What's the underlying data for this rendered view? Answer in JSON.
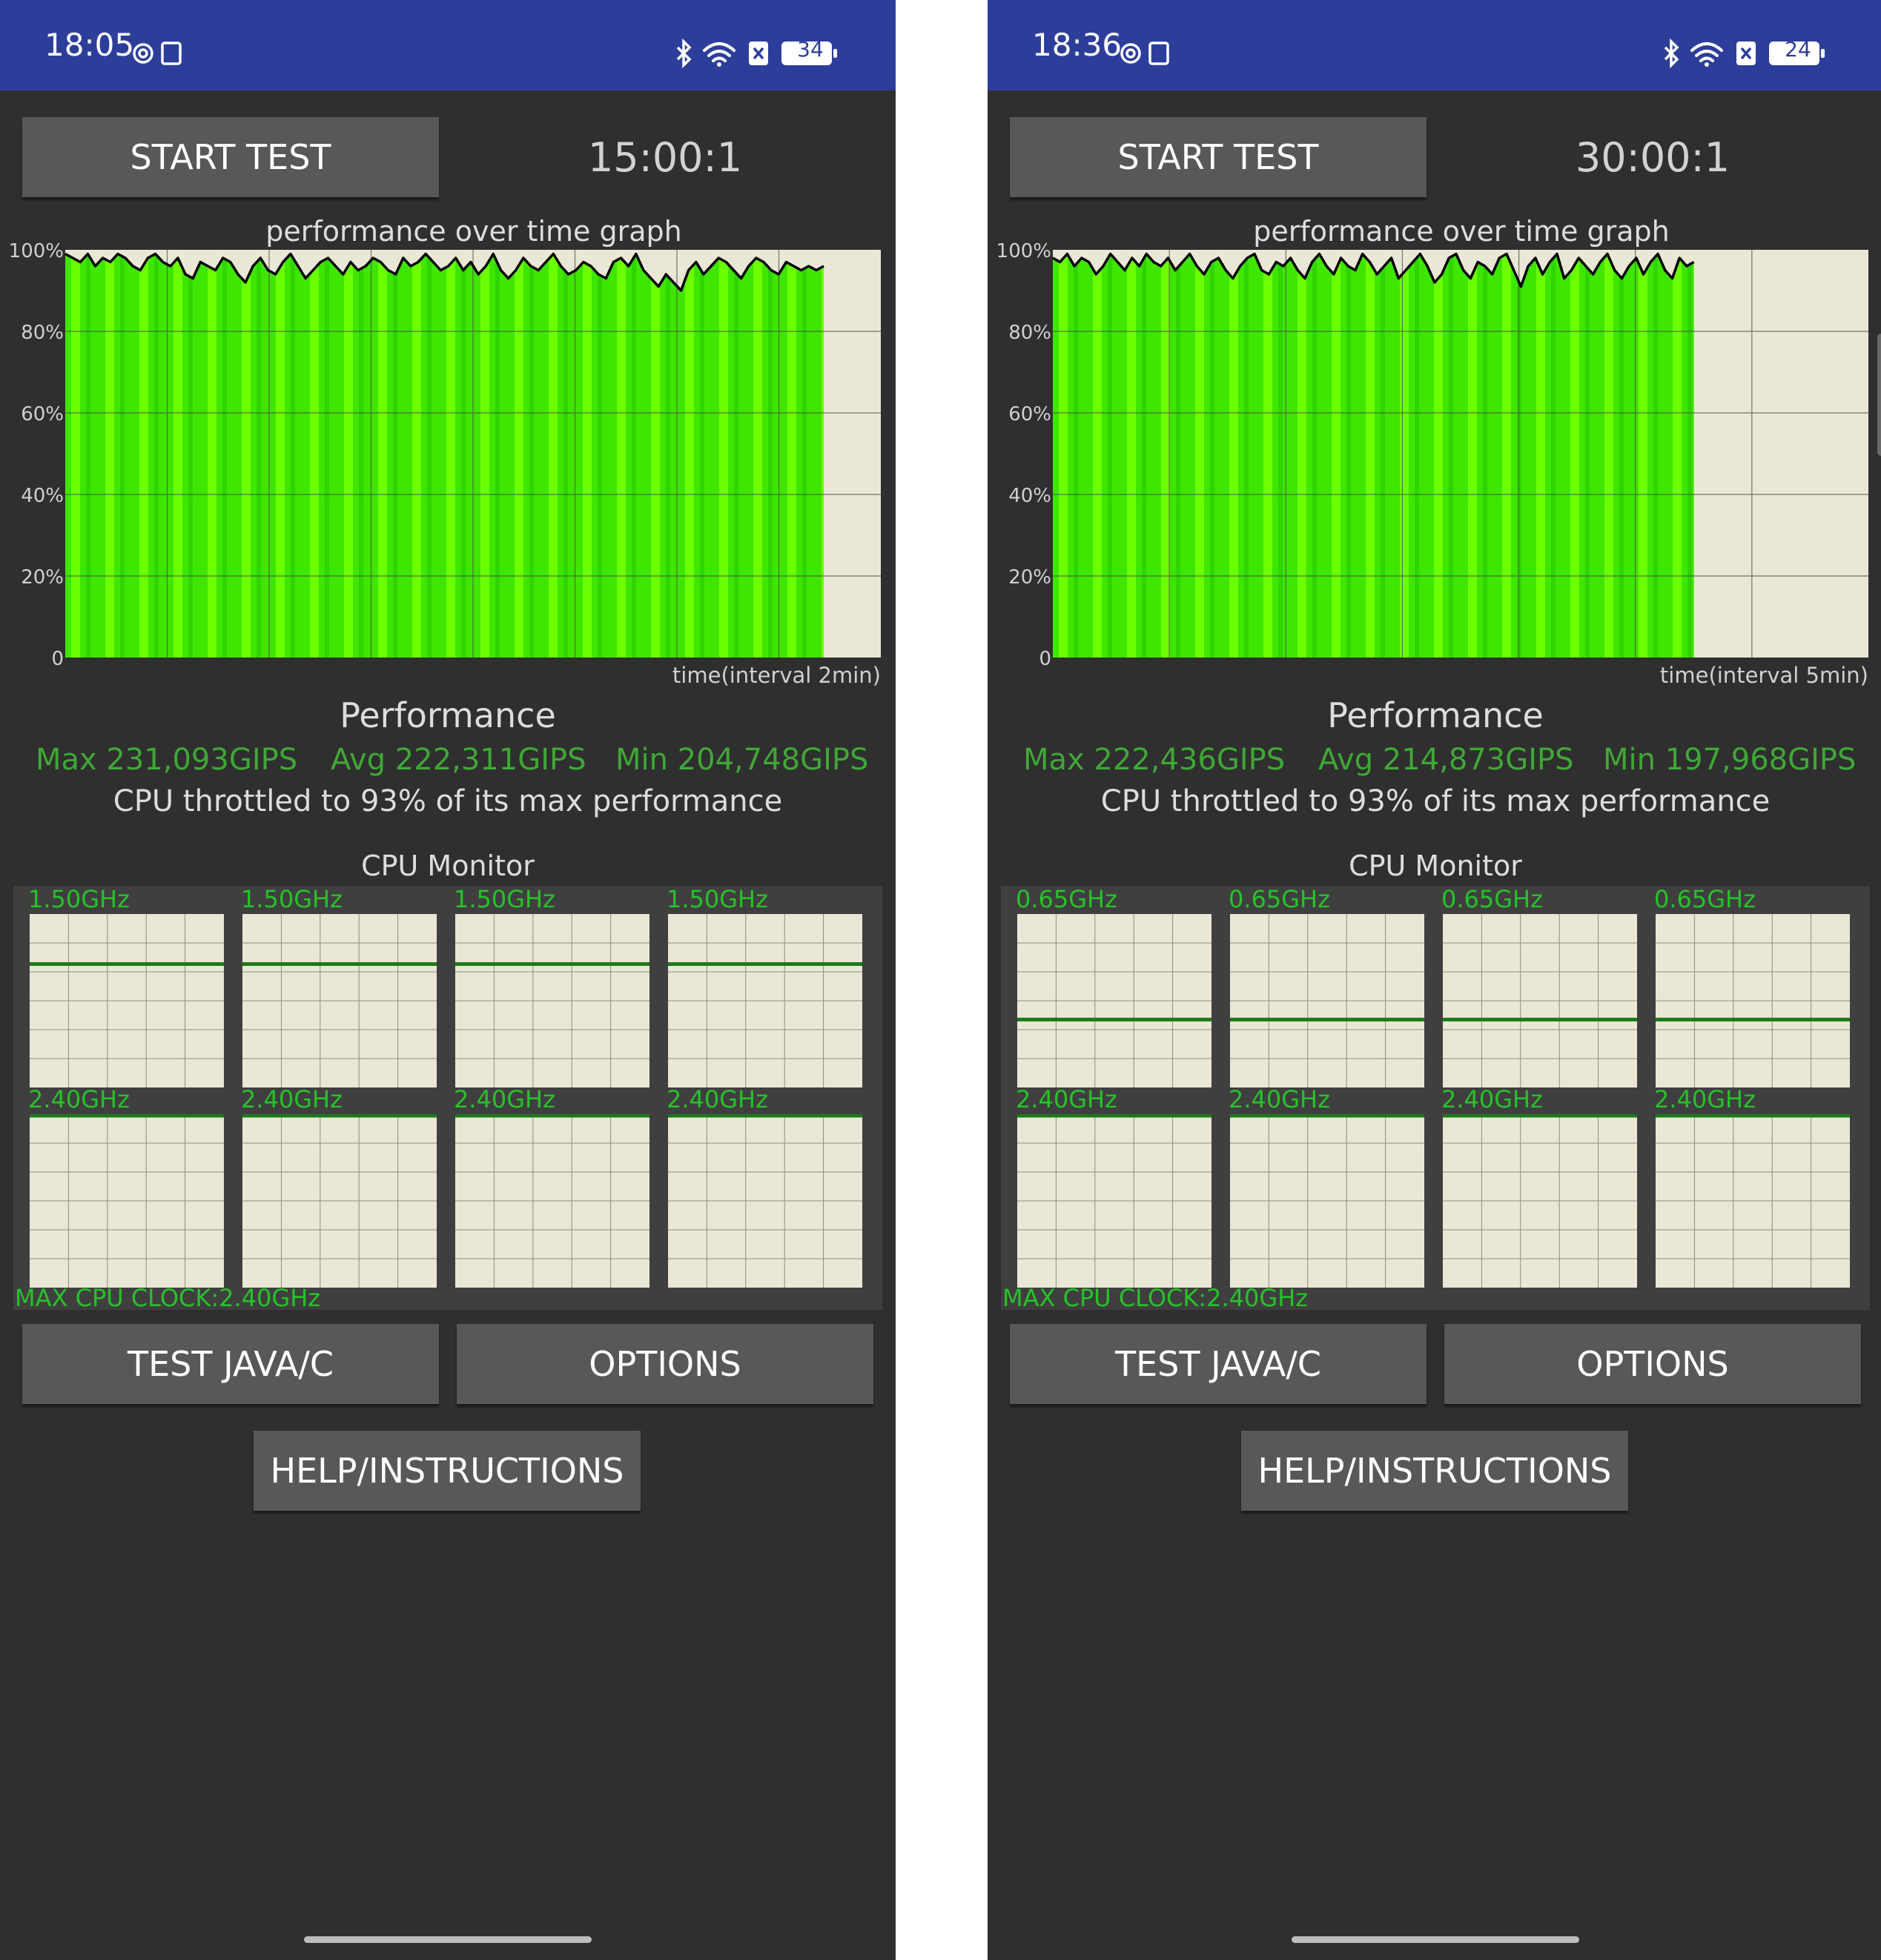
{
  "colors": {
    "status_bar": "#2d3e9a",
    "background": "#2f2f2f",
    "button": "#585858",
    "accent_green": "#3fa836",
    "core_green": "#1c7a1c",
    "graph_fill": "#44f000",
    "graph_bg": "#ebe7d6"
  },
  "screens": [
    {
      "status": {
        "time": "18:05",
        "battery": "34",
        "icons": [
          "settings-icon",
          "screen-record-icon",
          "bluetooth-icon",
          "wifi-icon",
          "sim-x-icon",
          "battery-icon"
        ]
      },
      "buttons": {
        "start": "START TEST",
        "java": "TEST JAVA/C",
        "options": "OPTIONS",
        "help": "HELP/INSTRUCTIONS"
      },
      "timer": "15:00:1",
      "graph_title": "performance over time graph",
      "performance": {
        "title": "Performance",
        "max": "Max 231,093GIPS",
        "avg": "Avg 222,311GIPS",
        "min": "Min 204,748GIPS",
        "throttle": "CPU throttled to 93% of its max performance"
      },
      "cpu_monitor": {
        "title": "CPU Monitor",
        "top_label": "1.50GHz",
        "bottom_label": "2.40GHz",
        "max_clock": "MAX CPU CLOCK:2.40GHz"
      },
      "chart_data": {
        "type": "area",
        "y_ticks": [
          "100%",
          "80%",
          "60%",
          "40%",
          "20%",
          "0"
        ],
        "ylim": [
          0,
          100
        ],
        "xlabel": "time(interval 2min)",
        "progress": 0.93,
        "x_grid_intervals": 8,
        "values": [
          99,
          98,
          97,
          99,
          96,
          98,
          97,
          99,
          98,
          96,
          95,
          98,
          99,
          97,
          96,
          98,
          94,
          93,
          97,
          96,
          95,
          98,
          97,
          94,
          92,
          96,
          98,
          95,
          94,
          97,
          99,
          96,
          93,
          95,
          97,
          98,
          96,
          94,
          97,
          95,
          96,
          98,
          97,
          95,
          94,
          98,
          96,
          97,
          99,
          97,
          95,
          96,
          98,
          95,
          97,
          94,
          96,
          99,
          95,
          93,
          95,
          98,
          96,
          95,
          97,
          99,
          96,
          94,
          95,
          97,
          96,
          94,
          93,
          97,
          98,
          96,
          99,
          95,
          93,
          91,
          94,
          92,
          90,
          95,
          97,
          94,
          96,
          98,
          97,
          95,
          93,
          96,
          98,
          97,
          95,
          94,
          97,
          96,
          95,
          96,
          95,
          96
        ],
        "cores_top": [
          [
            0.72,
            0.72,
            0.72,
            0.72,
            0.72,
            0.72,
            0.72,
            0.72,
            0.72,
            0.72,
            0.72,
            0.72,
            0.72,
            0.72,
            0.72,
            0.72,
            0.72,
            0.72,
            0.72,
            0.72,
            0.72,
            0.72,
            0.72,
            0.72,
            0.72,
            0.72,
            0.72,
            0.72,
            0.72,
            0.72,
            0.72,
            0.72,
            0.72,
            0.72,
            0.72,
            0.72,
            0.72,
            0.72,
            0.72,
            0.72,
            0.72,
            0.72,
            0.72,
            0.72,
            0.72,
            0.72,
            0.72,
            0.72,
            0.72,
            0.72
          ],
          [
            0.72,
            0.72,
            0.72,
            0.72,
            0.72,
            0.72,
            0.72,
            0.72,
            0.72,
            0.72,
            0.72,
            0.72,
            0.72,
            0.72,
            0.72,
            0.72,
            0.72,
            0.72,
            0.72,
            0.72,
            0.72,
            0.72,
            0.72,
            0.72,
            0.72,
            0.72,
            0.72,
            0.72,
            0.72,
            0.72,
            0.72,
            0.72,
            0.72,
            0.72,
            0.72,
            0.72,
            0.72,
            0.72,
            0.72,
            0.72,
            0.72,
            0.72,
            0.72,
            0.72,
            0.72,
            0.72,
            0.72,
            0.72,
            0.72,
            0.72
          ],
          [
            0.72,
            0.72,
            0.72,
            0.72,
            0.72,
            0.72,
            0.72,
            0.72,
            0.72,
            0.72,
            0.72,
            0.72,
            0.72,
            0.72,
            0.72,
            0.72,
            0.72,
            0.72,
            0.72,
            0.72,
            0.72,
            0.72,
            0.72,
            0.72,
            0.72,
            0.72,
            0.72,
            0.72,
            0.72,
            0.72,
            0.72,
            0.72,
            0.72,
            0.72,
            0.72,
            0.72,
            0.72,
            0.72,
            0.72,
            0.72,
            0.72,
            0.72,
            0.72,
            0.72,
            0.72,
            0.72,
            0.72,
            0.72,
            0.72,
            0.72
          ],
          [
            0.72,
            0.72,
            0.72,
            0.72,
            0.72,
            0.72,
            0.72,
            0.72,
            0.72,
            0.72,
            0.72,
            0.72,
            0.72,
            0.72,
            0.72,
            0.72,
            0.72,
            0.72,
            0.72,
            0.72,
            0.72,
            0.72,
            0.72,
            0.72,
            0.72,
            0.72,
            0.72,
            0.72,
            0.72,
            0.72,
            0.72,
            0.72,
            0.72,
            0.72,
            0.72,
            0.72,
            0.72,
            0.72,
            0.72,
            0.72,
            0.72,
            0.72,
            0.72,
            0.72,
            0.72,
            0.72,
            0.72,
            0.72,
            0.72,
            0.72
          ]
        ],
        "cores_bottom": [
          [
            1,
            1,
            1,
            1,
            1,
            1,
            1,
            1,
            1,
            1,
            1,
            1,
            1,
            1,
            1,
            1,
            1,
            1,
            1,
            1,
            1,
            1,
            1,
            1,
            1,
            1,
            1,
            1,
            1,
            1,
            1,
            1,
            1,
            1,
            1,
            1,
            1,
            1,
            1,
            1,
            1,
            1,
            1,
            1,
            1,
            1,
            1,
            1,
            1,
            1
          ],
          [
            1,
            1,
            1,
            1,
            1,
            1,
            1,
            1,
            1,
            1,
            1,
            1,
            1,
            1,
            1,
            1,
            1,
            1,
            1,
            1,
            1,
            1,
            1,
            1,
            1,
            1,
            1,
            1,
            1,
            1,
            1,
            1,
            1,
            1,
            1,
            1,
            1,
            1,
            1,
            1,
            1,
            1,
            1,
            1,
            1,
            1,
            1,
            1,
            1,
            1
          ],
          [
            1,
            1,
            1,
            1,
            1,
            1,
            1,
            1,
            1,
            1,
            1,
            1,
            1,
            1,
            1,
            1,
            1,
            1,
            1,
            1,
            1,
            1,
            1,
            1,
            1,
            1,
            1,
            1,
            1,
            1,
            1,
            1,
            1,
            1,
            1,
            1,
            1,
            1,
            1,
            1,
            1,
            1,
            1,
            1,
            1,
            1,
            1,
            1,
            1,
            1
          ],
          [
            1,
            1,
            1,
            1,
            1,
            1,
            1,
            1,
            1,
            1,
            1,
            1,
            1,
            1,
            1,
            1,
            1,
            1,
            1,
            1,
            1,
            1,
            1,
            1,
            1,
            1,
            1,
            1,
            1,
            1,
            1,
            1,
            1,
            1,
            1,
            1,
            1,
            1,
            1,
            1,
            1,
            1,
            1,
            1,
            1,
            1,
            1,
            1,
            1,
            1
          ]
        ]
      }
    },
    {
      "status": {
        "time": "18:36",
        "battery": "24",
        "icons": [
          "settings-icon",
          "screen-record-icon",
          "bluetooth-icon",
          "wifi-icon",
          "sim-x-icon",
          "battery-icon"
        ]
      },
      "buttons": {
        "start": "START TEST",
        "java": "TEST JAVA/C",
        "options": "OPTIONS",
        "help": "HELP/INSTRUCTIONS"
      },
      "timer": "30:00:1",
      "graph_title": "performance over time graph",
      "performance": {
        "title": "Performance",
        "max": "Max 222,436GIPS",
        "avg": "Avg 214,873GIPS",
        "min": "Min 197,968GIPS",
        "throttle": "CPU throttled to 93% of its max performance"
      },
      "cpu_monitor": {
        "title": "CPU Monitor",
        "top_label": "0.65GHz",
        "bottom_label": "2.40GHz",
        "max_clock": "MAX CPU CLOCK:2.40GHz"
      },
      "chart_data": {
        "type": "area",
        "y_ticks": [
          "100%",
          "80%",
          "60%",
          "40%",
          "20%",
          "0"
        ],
        "ylim": [
          0,
          100
        ],
        "xlabel": "time(interval 5min)",
        "progress": 0.786,
        "x_grid_intervals": 7,
        "values": [
          98,
          97,
          99,
          96,
          98,
          97,
          94,
          96,
          99,
          97,
          95,
          98,
          96,
          99,
          97,
          96,
          98,
          95,
          97,
          99,
          96,
          94,
          97,
          98,
          95,
          93,
          96,
          98,
          99,
          95,
          94,
          97,
          96,
          98,
          95,
          93,
          97,
          99,
          96,
          94,
          98,
          96,
          95,
          99,
          97,
          94,
          96,
          98,
          93,
          95,
          97,
          99,
          96,
          92,
          94,
          98,
          99,
          95,
          93,
          97,
          96,
          94,
          98,
          99,
          95,
          91,
          96,
          98,
          94,
          97,
          99,
          93,
          95,
          98,
          96,
          94,
          97,
          99,
          95,
          93,
          96,
          98,
          94,
          97,
          99,
          95,
          93,
          98,
          96,
          97
        ],
        "cores_top": [
          [
            0.4,
            0.4,
            0.4,
            0.4,
            0.4,
            0.4,
            0.4,
            0.4,
            0.4,
            0.4,
            0.4,
            0.4,
            0.4,
            0.4,
            0.4,
            0.4,
            0.4,
            0.4,
            0.4,
            0.4,
            0.4,
            0.4,
            0.4,
            0.4,
            0.4,
            0.4,
            0.4,
            0.4,
            0.4,
            0.4,
            0.4,
            0.4,
            0.4,
            0.4,
            0.4,
            0.4,
            0.4,
            0.4,
            0.4,
            0.4,
            0.4,
            0.4,
            0.4,
            0.4,
            0.4,
            0.4,
            0.4,
            0.4,
            0.4,
            0.4
          ],
          [
            0.4,
            0.4,
            0.4,
            0.4,
            0.4,
            0.4,
            0.4,
            0.4,
            0.4,
            0.4,
            0.4,
            0.4,
            0.4,
            0.4,
            0.4,
            0.4,
            0.4,
            0.4,
            0.4,
            0.4,
            0.4,
            0.4,
            0.4,
            0.4,
            0.4,
            0.4,
            0.4,
            0.4,
            0.4,
            0.4,
            0.4,
            0.4,
            0.4,
            0.4,
            0.4,
            0.4,
            0.4,
            0.4,
            0.4,
            0.4,
            0.4,
            0.4,
            0.4,
            0.4,
            0.4,
            0.4,
            0.4,
            0.4,
            0.4,
            0.4
          ],
          [
            0.4,
            0.4,
            0.4,
            0.4,
            0.4,
            0.4,
            0.4,
            0.4,
            0.4,
            0.4,
            0.4,
            0.4,
            0.4,
            0.4,
            0.4,
            0.4,
            0.4,
            0.4,
            0.4,
            0.4,
            0.4,
            0.4,
            0.4,
            0.4,
            0.4,
            0.4,
            0.4,
            0.4,
            0.4,
            0.4,
            0.4,
            0.4,
            0.4,
            0.4,
            0.4,
            0.4,
            0.4,
            0.4,
            0.4,
            0.4,
            0.4,
            0.4,
            0.4,
            0.4,
            0.4,
            0.4,
            0.4,
            0.4,
            0.4,
            0.4
          ],
          [
            0.4,
            0.4,
            0.4,
            0.4,
            0.4,
            0.4,
            0.4,
            0.4,
            0.4,
            0.4,
            0.4,
            0.4,
            0.4,
            0.4,
            0.4,
            0.4,
            0.4,
            0.4,
            0.4,
            0.4,
            0.4,
            0.4,
            0.4,
            0.4,
            0.4,
            0.4,
            0.4,
            0.4,
            0.4,
            0.4,
            0.4,
            0.4,
            0.4,
            0.4,
            0.4,
            0.4,
            0.4,
            0.4,
            0.4,
            0.4,
            0.4,
            0.4,
            0.4,
            0.4,
            0.4,
            0.4,
            0.4,
            0.4,
            0.4,
            0.4
          ]
        ],
        "cores_bottom": [
          [
            1,
            1,
            1,
            1,
            1,
            1,
            1,
            1,
            1,
            1,
            1,
            1,
            1,
            1,
            1,
            1,
            1,
            1,
            1,
            1,
            1,
            1,
            1,
            1,
            1,
            1,
            1,
            1,
            1,
            1,
            1,
            1,
            1,
            1,
            1,
            1,
            1,
            1,
            1,
            1,
            1,
            1,
            1,
            1,
            1,
            1,
            1,
            1,
            1,
            1
          ],
          [
            1,
            1,
            1,
            1,
            1,
            1,
            1,
            1,
            1,
            1,
            1,
            1,
            1,
            1,
            1,
            1,
            1,
            1,
            1,
            1,
            1,
            1,
            1,
            1,
            1,
            1,
            1,
            1,
            1,
            1,
            1,
            1,
            1,
            1,
            1,
            1,
            1,
            1,
            1,
            1,
            1,
            1,
            1,
            1,
            1,
            1,
            1,
            1,
            1,
            1
          ],
          [
            1,
            1,
            1,
            1,
            1,
            1,
            1,
            1,
            1,
            1,
            1,
            1,
            1,
            1,
            1,
            1,
            1,
            1,
            1,
            1,
            1,
            1,
            1,
            1,
            1,
            1,
            1,
            1,
            1,
            1,
            1,
            1,
            1,
            1,
            1,
            1,
            1,
            1,
            1,
            1,
            1,
            1,
            1,
            1,
            1,
            1,
            1,
            1,
            1,
            1
          ],
          [
            1,
            1,
            1,
            1,
            1,
            1,
            1,
            1,
            1,
            1,
            1,
            1,
            1,
            1,
            1,
            1,
            1,
            1,
            1,
            1,
            1,
            1,
            1,
            1,
            1,
            1,
            1,
            1,
            1,
            1,
            1,
            1,
            1,
            1,
            1,
            1,
            1,
            1,
            1,
            1,
            1,
            1,
            1,
            1,
            1,
            1,
            1,
            1,
            1,
            1
          ]
        ]
      }
    }
  ]
}
